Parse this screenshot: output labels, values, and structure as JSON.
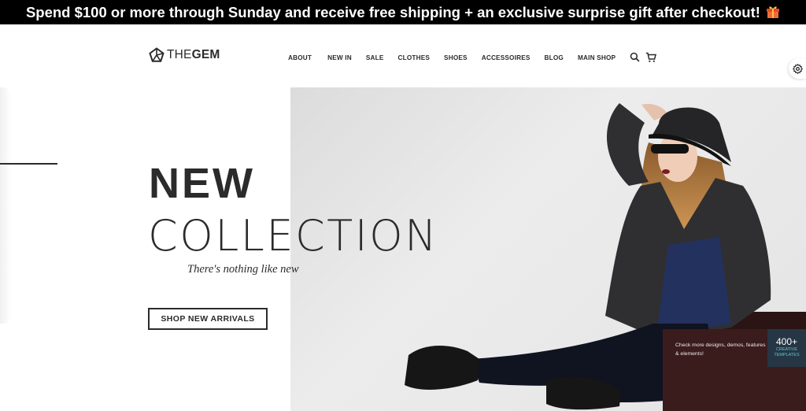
{
  "promo_bar": {
    "text": "Spend $100 or more through Sunday and receive free shipping + an exclusive surprise gift after checkout! ",
    "icon": "gift-icon"
  },
  "header": {
    "logo": {
      "prefix": "THE",
      "bold": "GEM",
      "icon": "pentagon-logo-icon"
    },
    "nav": [
      {
        "label": "ABOUT"
      },
      {
        "label": "NEW IN"
      },
      {
        "label": "SALE"
      },
      {
        "label": "CLOTHES"
      },
      {
        "label": "SHOES"
      },
      {
        "label": "ACCESSOIRES"
      },
      {
        "label": "BLOG"
      },
      {
        "label": "MAIN SHOP"
      }
    ],
    "icons": [
      "search-icon",
      "cart-icon"
    ]
  },
  "settings": {
    "icon": "gear-icon"
  },
  "hero": {
    "title_line1": "NEW",
    "title_line2": "COLLECTION",
    "tagline": "There's nothing like new",
    "cta_label": "SHOP NEW ARRIVALS"
  },
  "promo_card": {
    "text": "Check more designs, demos, features & elements!",
    "badge_number": "400+",
    "badge_line1": "CREATIVE",
    "badge_line2": "TEMPLATES"
  },
  "colors": {
    "promo_bg": "#000000",
    "text_dark": "#2b2b2b",
    "badge_accent": "#5fc7d3"
  }
}
